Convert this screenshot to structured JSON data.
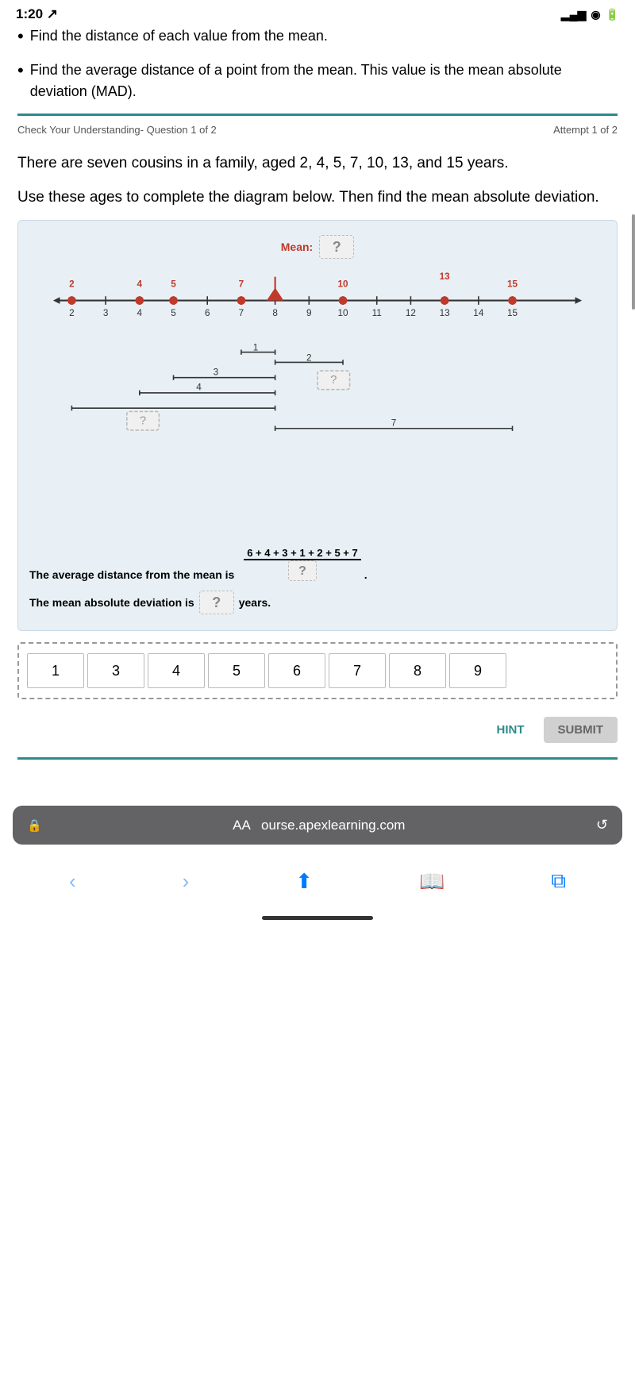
{
  "statusBar": {
    "time": "1:20",
    "arrow": "↗",
    "icons": "▂▄▆ ◉ 🔋"
  },
  "bullet1": "Find the distance of each value from the mean.",
  "bullet2": "Find the average distance of a point from the mean. This value is the mean absolute deviation (MAD).",
  "questionHeader": {
    "left": "Check Your Understanding- Question 1 of 2",
    "right": "Attempt 1 of 2"
  },
  "questionBody1": "There are seven cousins in a family, aged 2, 4, 5, 7, 10, 13, and 15 years.",
  "questionBody2": "Use these ages to complete the diagram below. Then find the mean absolute deviation.",
  "diagram": {
    "meanLabel": "Mean:",
    "meanBlank": "?",
    "numberLine": {
      "numbers": [
        2,
        3,
        4,
        5,
        6,
        7,
        8,
        9,
        10,
        11,
        12,
        13,
        14,
        15
      ],
      "points": [
        2,
        4,
        5,
        7,
        10,
        13,
        15
      ],
      "triangle": 8
    },
    "distances": [
      {
        "label": "1",
        "blank": null
      },
      {
        "label": "2",
        "blank": null
      },
      {
        "label": "3",
        "blank": "?"
      },
      {
        "label": "4",
        "blank": null
      },
      {
        "label": "?",
        "blank": null
      },
      {
        "label": "7",
        "blank": null
      }
    ],
    "avgDistanceLabel": "The average distance from the mean is",
    "fraction": {
      "top": "6 + 4 + 3 + 1 + 2 + 5 + 7",
      "bottom": "?"
    },
    "madLabel": "The mean absolute deviation is",
    "madBlank": "?",
    "madUnit": "years."
  },
  "tiles": [
    "1",
    "3",
    "4",
    "5",
    "6",
    "7",
    "8",
    "9"
  ],
  "buttons": {
    "hint": "HINT",
    "submit": "SUBMIT"
  },
  "browserBar": {
    "lock": "🔒",
    "url": "ourse.apexlearning.com",
    "reload": "↺"
  },
  "nav": {
    "back": "‹",
    "forward": "›",
    "share": "⬆",
    "bookmarks": "📖",
    "tabs": "⧉"
  }
}
